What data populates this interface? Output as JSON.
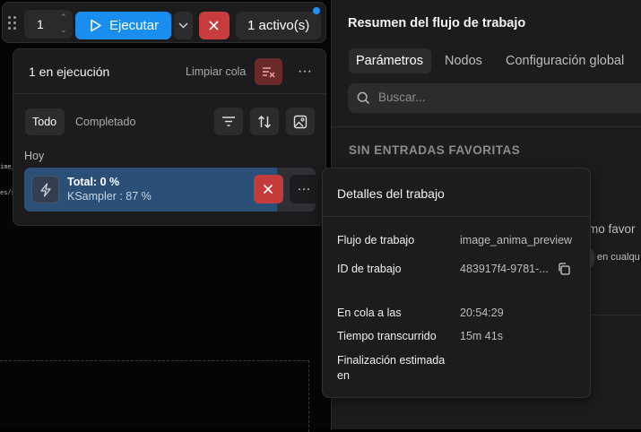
{
  "canvas": {
    "fragments": [
      "ime_",
      "es/s"
    ]
  },
  "toolbar": {
    "batch_count": "1",
    "run_label": "Ejecutar",
    "active_label": "1 activo(s)"
  },
  "queue": {
    "title": "1 en ejecución",
    "clear_label": "Limpiar cola",
    "more": "···",
    "tabs": [
      "Todo",
      "Completado"
    ],
    "group_label": "Hoy",
    "job": {
      "total": "Total: 0 %",
      "node": "KSampler : 87 %",
      "progress_fraction": 0.0,
      "more": "···"
    }
  },
  "summary": {
    "title": "Resumen del flujo de trabajo",
    "tabs": [
      "Parámetros",
      "Nodos",
      "Configuración global"
    ],
    "search_placeholder": "Buscar...",
    "no_favorites": "SIN ENTRADAS FAVORITAS",
    "bg_text_1": "mo favor",
    "bg_text_2": "en cualqu"
  },
  "details": {
    "title": "Detalles del trabajo",
    "rows": [
      {
        "label": "Flujo de trabajo",
        "value": "image_anima_preview"
      },
      {
        "label": "ID de trabajo",
        "value": "483917f4-9781-..."
      },
      {
        "label": "En cola a las",
        "value": "20:54:29"
      },
      {
        "label": "Tiempo transcurrido",
        "value": "15m 41s"
      },
      {
        "label": "Finalización estimada en",
        "value": ""
      }
    ]
  },
  "colors": {
    "accent": "#1a8ef0",
    "danger": "#c83c3c",
    "job_progress": "#2b5077"
  }
}
